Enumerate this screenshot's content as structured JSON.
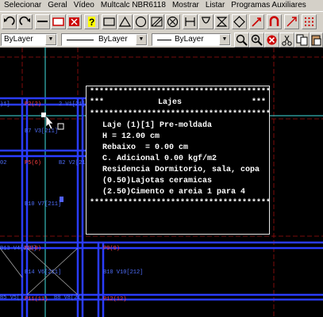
{
  "menu": [
    "Selecionar",
    "Geral",
    "Vídeo",
    "Multcalc NBR6118",
    "Mostrar",
    "Listar",
    "Programas Auxiliares"
  ],
  "layer_bar": {
    "layer": "ByLayer",
    "linetype": "ByLayer",
    "lineweight": "ByLayer"
  },
  "toolbar_icons": [
    "undo-icon",
    "redo-icon",
    "line-icon",
    "rectangle-icon",
    "cross-icon",
    "help-icon",
    "rect-tool-icon",
    "triangle-icon",
    "circle-icon",
    "hatch-icon",
    "circle-x-icon",
    "dimension-icon",
    "trim-icon",
    "hourglass-icon",
    "diamond-icon",
    "move-icon",
    "magnet-icon",
    "arrow-icon",
    "grid-icon"
  ],
  "toolbar2_icons": [
    "zoom-icon",
    "zoom-all-icon",
    "cancel-icon",
    "scissors-icon",
    "copy-icon",
    "paste-icon"
  ],
  "drawing_labels": {
    "p2": "P2(2)",
    "v1_top": "2 V1[21]",
    "v11_top": ")1]",
    "b7": "B7 V3[211]",
    "b11": "B11 V8[11]",
    "b10": "B10 V7[211]",
    "p6": "P5(6)",
    "v2": "B2 V2[212]",
    "v5": "V5[212]",
    "b2": "02",
    "b14": "B14 V6[211]",
    "b13": "B13 V4[212]",
    "p8": "P3(8)",
    "p9": "P9(9)",
    "p11": "P11(11)",
    "p12": "P12(12)",
    "b5": "B5 V5[]",
    "v8": "B8 V8[21]",
    "v10": "B10 V10[212]"
  },
  "lajes_dialog": {
    "border": "**************************************",
    "title_left": "***",
    "title": "Lajes",
    "title_right": "***",
    "line1": "Laje (1)[1] Pre-moldada",
    "line2": "H = 12.00 cm",
    "line3": "Rebaixo  = 0.00 cm",
    "line4": "C. Adicional 0.00 kgf/m2",
    "line5": "Residencia Dormitorio, sala, copa",
    "line6": "(0.50)Lajotas ceramicas",
    "line7": "(2.50)Cimento e areia 1 para 4",
    "border_bottom": "**************************************"
  }
}
